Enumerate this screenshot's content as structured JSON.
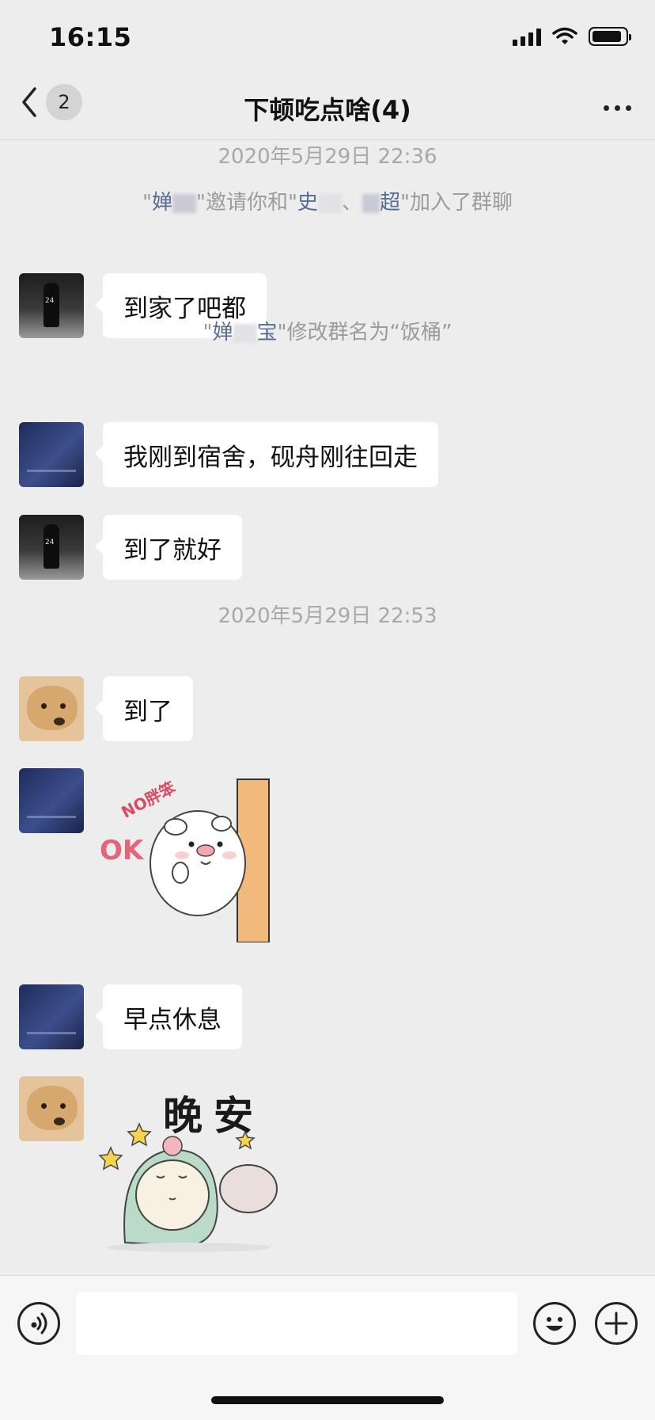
{
  "status_bar": {
    "time": "16:15",
    "battery_level": 0.9
  },
  "nav": {
    "unread_count": "2",
    "title": "下顿吃点啥(4)"
  },
  "chat": {
    "ts1": "2020年5月29日 22:36",
    "sys1": {
      "q1": "\"",
      "n1": "婵",
      "mid": "\"邀请你和\"",
      "n2": "史",
      "sep": "、",
      "n3": "超",
      "tail": "\"加入了群聊"
    },
    "msg1": "到家了吧都",
    "sys2": {
      "q1": "\"",
      "n1": "婵",
      "n1b": "宝",
      "tail": "\"修改群名为“饭桶”"
    },
    "msg2": "我刚到宿舍，砚舟刚往回走",
    "msg3": "到了就好",
    "ts2": "2020年5月29日 22:53",
    "msg4": "到了",
    "sticker1": {
      "bubble_text": "NO胖笨",
      "text": "OK"
    },
    "msg5": "早点休息",
    "sticker2": {
      "text": "晚安"
    }
  },
  "input_bar": {
    "placeholder": ""
  },
  "colors": {
    "background": "#ededed",
    "bubble": "#ffffff",
    "name_link": "#576b95"
  }
}
